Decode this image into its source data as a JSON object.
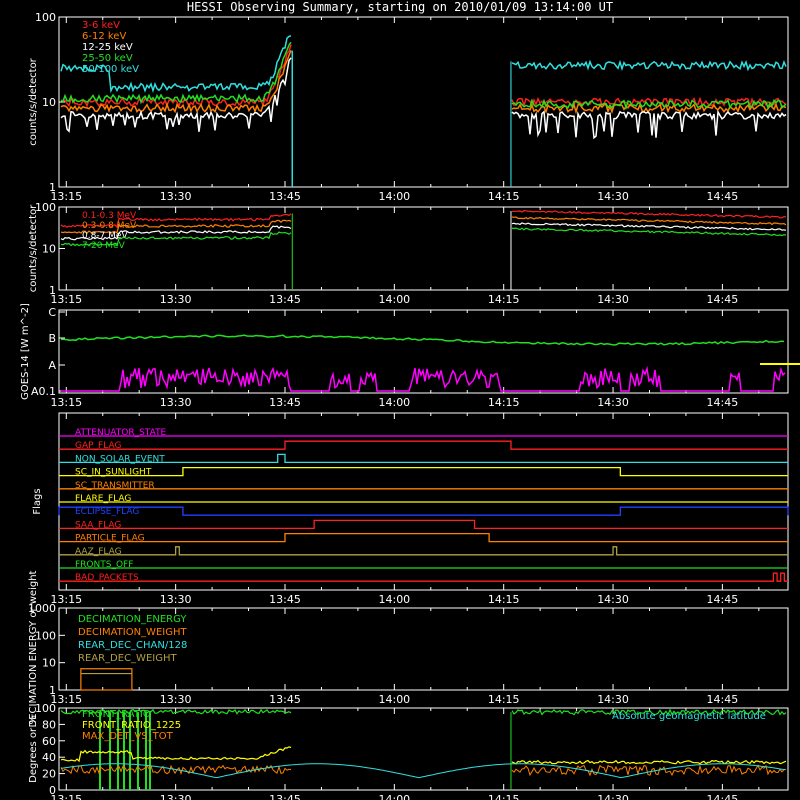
{
  "title": "HESSI Observing Summary, starting on 2010/01/09 13:14:00 UT",
  "time_ticks": [
    "13:15",
    "13:30",
    "13:45",
    "14:00",
    "14:15",
    "14:30",
    "14:45"
  ],
  "colors": {
    "red": "#ff2020",
    "orange": "#ff8000",
    "white": "#ffffff",
    "green": "#20e020",
    "cyan": "#30e0e0",
    "yellow": "#ffff00",
    "magenta": "#ff00ff",
    "blue": "#2040ff",
    "olive": "#b0a040",
    "frame": "#ffffff"
  },
  "chart_data": [
    {
      "type": "line",
      "panel": "low-energy-rates",
      "ylabel": "counts/s/detector",
      "y_scale": "log",
      "ylim": [
        1,
        100
      ],
      "y_ticks": [
        "1",
        "10",
        "100"
      ],
      "gap": [
        "13:46",
        "14:16"
      ],
      "series": [
        {
          "name": "3-6 keV",
          "color": "#ff2020",
          "before": 10,
          "after": 10
        },
        {
          "name": "6-12 keV",
          "color": "#ff8000",
          "before": 8.5,
          "after": 8.5
        },
        {
          "name": "12-25 keV",
          "color": "#ffffff",
          "before": 7,
          "after": 7
        },
        {
          "name": "25-50 keV",
          "color": "#20e020",
          "before": 11,
          "after": 9.5
        },
        {
          "name": "50-100 keV",
          "color": "#30e0e0",
          "before": 25,
          "after": 27
        }
      ]
    },
    {
      "type": "line",
      "panel": "high-energy-rates",
      "ylabel": "counts/s/detector",
      "y_scale": "log",
      "ylim": [
        1,
        100
      ],
      "y_ticks": [
        "1",
        "10",
        "100"
      ],
      "series": [
        {
          "name": "0.1-0.3 MeV",
          "color": "#ff2020",
          "before": 50,
          "after": 80
        },
        {
          "name": "0.3-0.8 MeV",
          "color": "#ff8000",
          "before": 35,
          "after": 55
        },
        {
          "name": "0.8-7 MeV",
          "color": "#ffffff",
          "before": 25,
          "after": 40
        },
        {
          "name": "7-20 MeV",
          "color": "#20e020",
          "before": 18,
          "after": 30
        }
      ]
    },
    {
      "type": "line",
      "panel": "goes",
      "ylabel": "GOES-14 [W m^-2]",
      "y_ticks": [
        "A0.1",
        "A",
        "B",
        "C"
      ]
    },
    {
      "type": "table",
      "panel": "flags",
      "ylabel": "Flags",
      "flags": [
        {
          "name": "ATTENUATOR_STATE",
          "color": "#ff00ff"
        },
        {
          "name": "GAP_FLAG",
          "color": "#ff2020"
        },
        {
          "name": "NON_SOLAR_EVENT",
          "color": "#30e0e0"
        },
        {
          "name": "SC_IN_SUNLIGHT",
          "color": "#ffff00"
        },
        {
          "name": "SC_TRANSMITTER",
          "color": "#ff8000"
        },
        {
          "name": "FLARE_FLAG",
          "color": "#ffff00"
        },
        {
          "name": "ECLIPSE_FLAG",
          "color": "#2040ff"
        },
        {
          "name": "SAA_FLAG",
          "color": "#ff2020"
        },
        {
          "name": "PARTICLE_FLAG",
          "color": "#ff8000"
        },
        {
          "name": "AAZ_FLAG",
          "color": "#b0a040"
        },
        {
          "name": "FRONTS_OFF",
          "color": "#20e020"
        },
        {
          "name": "BAD_PACKETS",
          "color": "#ff2020"
        }
      ]
    },
    {
      "type": "line",
      "panel": "decimation",
      "ylabel": "DECIMATION ENERGY or weight",
      "y_scale": "log",
      "ylim": [
        1,
        1000
      ],
      "y_ticks": [
        "1",
        "10",
        "100",
        "1000"
      ],
      "series": [
        {
          "name": "DECIMATION_ENERGY",
          "color": "#20e020"
        },
        {
          "name": "DECIMATION_WEIGHT",
          "color": "#ff8000"
        },
        {
          "name": "REAR_DEC_CHAN/128",
          "color": "#30e0e0"
        },
        {
          "name": "REAR_DEC_WEIGHT",
          "color": "#b0a040"
        }
      ]
    },
    {
      "type": "line",
      "panel": "fronts",
      "ylabel": "Degrees or %",
      "ylim": [
        0,
        100
      ],
      "y_ticks": [
        "0",
        "20",
        "40",
        "60",
        "80",
        "100"
      ],
      "series": [
        {
          "name": "FRONT_RATIO",
          "color": "#20e020"
        },
        {
          "name": "FRONT_RATIO_1225",
          "color": "#ffff00"
        },
        {
          "name": "MAX_DET_VS_TOT",
          "color": "#ff8000"
        },
        {
          "name": "Absolute geomagnetic latitude",
          "color": "#30e0e0"
        }
      ]
    }
  ]
}
